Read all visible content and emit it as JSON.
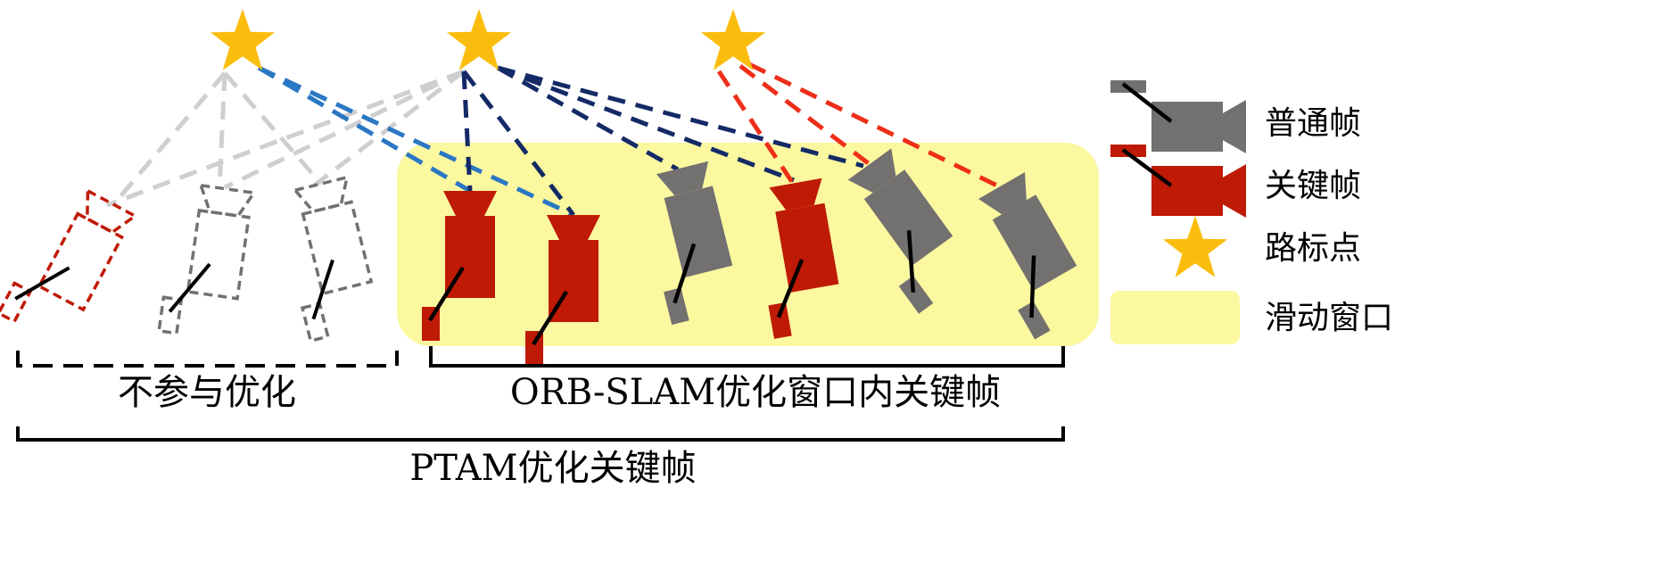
{
  "colors": {
    "regular_frame": "#737070",
    "keyframe": "#bf1a06",
    "landmark": "#fbbd0d",
    "sliding_window": "#fbf8a0",
    "link_gray": "#cfcfcf",
    "link_light_blue": "#2a77c4",
    "link_navy": "#142a66",
    "link_red": "#ef2e1a"
  },
  "legend": {
    "regular_frame": "普通帧",
    "keyframe": "关键帧",
    "landmark": "路标点",
    "sliding_window": "滑动窗口"
  },
  "brackets": {
    "not_optimized": "不参与优化",
    "orb_slam": "ORB-SLAM优化窗口内关键帧",
    "ptam": "PTAM优化关键帧"
  },
  "icons": {
    "camera": "camera-icon",
    "star": "star-icon"
  }
}
